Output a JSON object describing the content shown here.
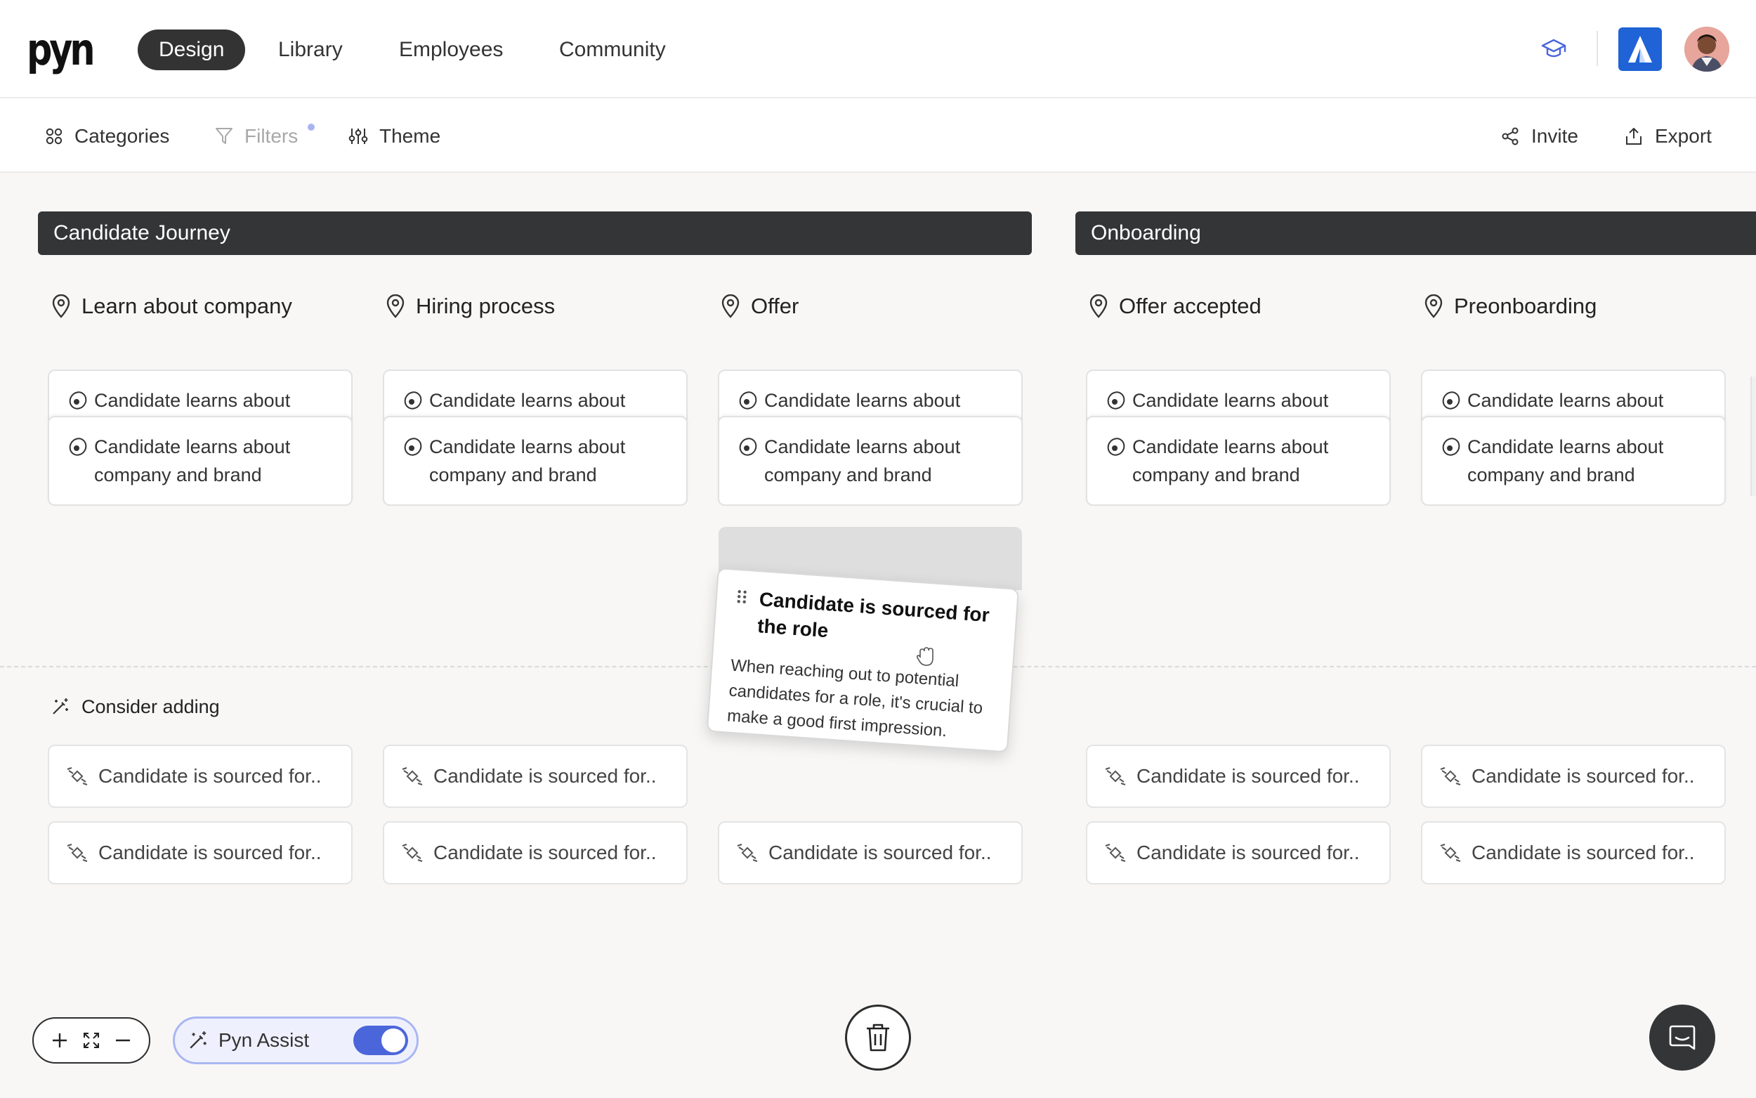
{
  "nav": {
    "logo": "pyn",
    "tabs": [
      "Design",
      "Library",
      "Employees",
      "Community"
    ],
    "active_tab": "Design"
  },
  "toolbar": {
    "categories": "Categories",
    "filters": "Filters",
    "theme": "Theme",
    "invite": "Invite",
    "export": "Export"
  },
  "stages": [
    {
      "title": "Candidate Journey"
    },
    {
      "title": "Onboarding"
    }
  ],
  "steps": [
    {
      "title": "Learn about company",
      "card_back": "Candidate learns about",
      "card_front_line1": "Candidate learns about",
      "card_front_line2": "company and brand"
    },
    {
      "title": "Hiring process",
      "card_back": "Candidate learns about",
      "card_front_line1": "Candidate learns about",
      "card_front_line2": "company and brand"
    },
    {
      "title": "Offer",
      "card_back": "Candidate learns about",
      "card_front_line1": "Candidate learns about",
      "card_front_line2": "company and brand"
    },
    {
      "title": "Offer accepted",
      "card_back": "Candidate learns about",
      "card_front_line1": "Candidate learns about",
      "card_front_line2": "company and brand"
    },
    {
      "title": "Preonboarding",
      "card_back": "Candidate learns about",
      "card_front_line1": "Candidate learns about",
      "card_front_line2": "company and brand"
    }
  ],
  "consider_adding": "Consider adding",
  "suggestion_text": "Candidate is sourced for..",
  "dragged_card": {
    "title": "Candidate is sourced for the role",
    "description": "When reaching out to potential candidates for a role, it's crucial to make a good first impression."
  },
  "assist": {
    "label": "Pyn Assist",
    "enabled": true
  },
  "colors": {
    "accent": "#4b66db",
    "stage_bar": "#333537",
    "app_logo": "#1f63d6"
  }
}
